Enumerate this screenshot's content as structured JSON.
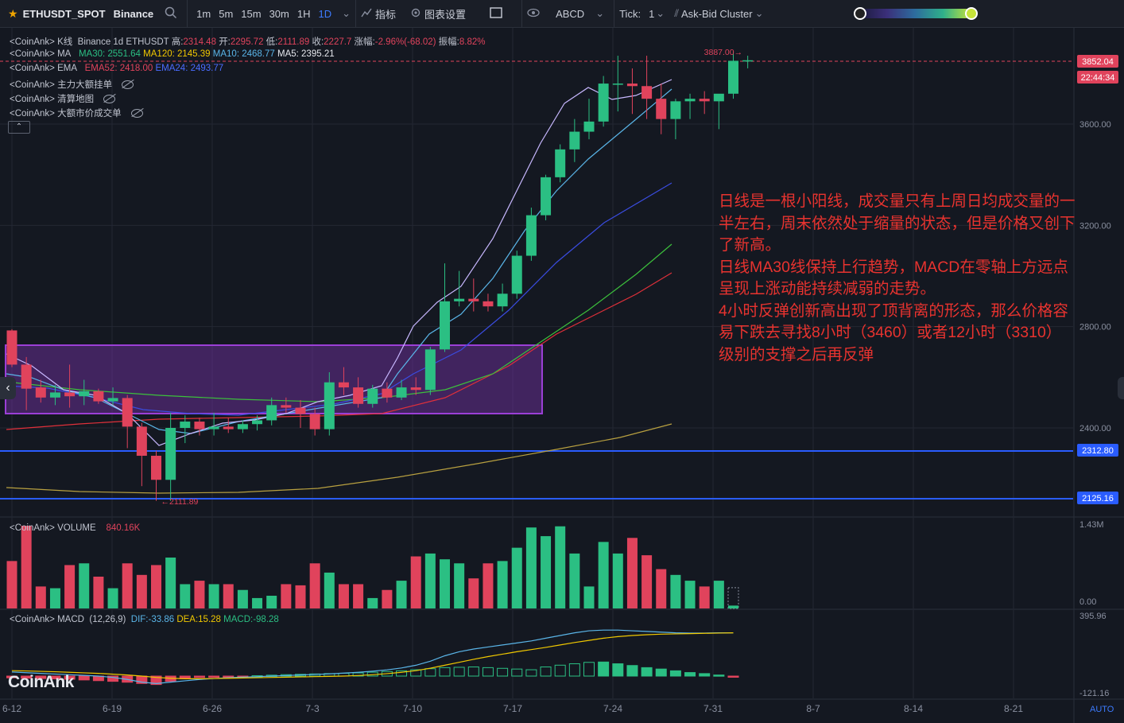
{
  "toolbar": {
    "symbol": "ETHUSDT_SPOT",
    "exchange": "Binance",
    "timeframes": [
      "1m",
      "5m",
      "15m",
      "30m",
      "1H",
      "1D"
    ],
    "active_timeframe": "1D",
    "indicators_label": "指标",
    "chart_settings_label": "图表设置",
    "abcd_label": "ABCD",
    "tick_label": "Tick:",
    "tick_value": "1",
    "cluster_label": "Ask-Bid Cluster"
  },
  "legend": {
    "kline": {
      "prefix": "<CoinAnk> K线",
      "source": "Binance 1d ETHUSDT",
      "high_label": "高:",
      "high": "2314.48",
      "open_label": "开:",
      "open": "2295.72",
      "low_label": "低:",
      "low": "2111.89",
      "close_label": "收:",
      "close": "2227.7",
      "change_label": "涨幅:",
      "change": "-2.96%(-68.02)",
      "amp_label": "振幅:",
      "amp": "8.82%"
    },
    "ma": {
      "prefix": "<CoinAnk> MA",
      "ma30": "MA30: 2551.64",
      "ma120": "MA120: 2145.39",
      "ma10": "MA10: 2468.77",
      "ma5": "MA5: 2395.21"
    },
    "ema": {
      "prefix": "<CoinAnk> EMA",
      "ema52": "EMA52: 2418.00",
      "ema24": "EMA24: 2493.77"
    },
    "orders": "<CoinAnk> 主力大额挂单",
    "liq": "<CoinAnk> 清算地图",
    "bigtrades": "<CoinAnk> 大额市价成交单",
    "volume_prefix": "<CoinAnk> VOLUME",
    "volume_value": "840.16K",
    "macd_prefix": "<CoinAnk> MACD",
    "macd_params": "(12,26,9)",
    "dif": "DIF:-33.86",
    "dea": "DEA:15.28",
    "macd": "MACD:-98.28"
  },
  "annotation": "日线是一根小阳线，成交量只有上周日均成交量的一半左右，周末依然处于缩量的状态，但是价格又创下了新高。\n日线MA30线保持上行趋势，MACD在零轴上方远点呈现上涨动能持续减弱的走势。\n4小时反弹创新高出现了顶背离的形态，那么价格容易下跌去寻找8小时（3460）或者12小时（3310）级别的支撑之后再反弹",
  "watermark": "CoinAnk",
  "auto_label": "AUTO",
  "colors": {
    "up": "#2bbf83",
    "down": "#e0435c",
    "bg": "#141821",
    "grid": "#232733",
    "box": "#9b3fd6",
    "hline": "#2a5cff"
  },
  "chart_data": {
    "type": "candlestick",
    "price_axis": {
      "ticks": [
        "3600.00",
        "3200.00",
        "2800.00",
        "2400.00"
      ],
      "min": 2000,
      "max": 3950
    },
    "x_ticks": [
      "6-12",
      "6-19",
      "6-26",
      "7-3",
      "7-10",
      "7-17",
      "7-24",
      "7-31",
      "8-7",
      "8-14",
      "8-21"
    ],
    "price_labels": {
      "current": "3852.04",
      "countdown": "22:44:34",
      "level1": "2312.80",
      "level2": "2125.16",
      "high_mark": "3887.00",
      "low_mark": "2111.89"
    },
    "candles": [
      [
        2785,
        2790,
        2640,
        2650
      ],
      [
        2650,
        2680,
        2470,
        2555
      ],
      [
        2560,
        2590,
        2500,
        2520
      ],
      [
        2520,
        2570,
        2490,
        2540
      ],
      [
        2540,
        2650,
        2480,
        2525
      ],
      [
        2525,
        2590,
        2490,
        2545
      ],
      [
        2545,
        2555,
        2495,
        2505
      ],
      [
        2505,
        2560,
        2490,
        2518
      ],
      [
        2518,
        2530,
        2320,
        2405
      ],
      [
        2405,
        2420,
        2170,
        2290
      ],
      [
        2290,
        2310,
        2112,
        2195
      ],
      [
        2195,
        2460,
        2112,
        2400
      ],
      [
        2400,
        2450,
        2340,
        2425
      ],
      [
        2425,
        2440,
        2370,
        2395
      ],
      [
        2395,
        2460,
        2370,
        2405
      ],
      [
        2405,
        2440,
        2380,
        2395
      ],
      [
        2395,
        2430,
        2380,
        2415
      ],
      [
        2415,
        2450,
        2390,
        2430
      ],
      [
        2430,
        2520,
        2410,
        2490
      ],
      [
        2490,
        2520,
        2460,
        2480
      ],
      [
        2480,
        2510,
        2400,
        2455
      ],
      [
        2455,
        2480,
        2370,
        2395
      ],
      [
        2395,
        2620,
        2370,
        2580
      ],
      [
        2580,
        2640,
        2530,
        2560
      ],
      [
        2560,
        2600,
        2480,
        2495
      ],
      [
        2495,
        2570,
        2480,
        2555
      ],
      [
        2555,
        2580,
        2500,
        2520
      ],
      [
        2520,
        2590,
        2510,
        2560
      ],
      [
        2560,
        2600,
        2530,
        2550
      ],
      [
        2550,
        2720,
        2530,
        2710
      ],
      [
        2710,
        3050,
        2700,
        2900
      ],
      [
        2900,
        3020,
        2880,
        2910
      ],
      [
        2910,
        2990,
        2860,
        2900
      ],
      [
        2900,
        2930,
        2860,
        2880
      ],
      [
        2880,
        2970,
        2860,
        2930
      ],
      [
        2930,
        3100,
        2910,
        3080
      ],
      [
        3080,
        3270,
        3060,
        3240
      ],
      [
        3240,
        3400,
        3220,
        3390
      ],
      [
        3390,
        3520,
        3370,
        3500
      ],
      [
        3500,
        3620,
        3450,
        3570
      ],
      [
        3570,
        3700,
        3540,
        3610
      ],
      [
        3610,
        3790,
        3590,
        3760
      ],
      [
        3760,
        3870,
        3650,
        3760
      ],
      [
        3760,
        3820,
        3640,
        3750
      ],
      [
        3750,
        3870,
        3620,
        3700
      ],
      [
        3700,
        3760,
        3560,
        3620
      ],
      [
        3620,
        3700,
        3540,
        3690
      ],
      [
        3690,
        3720,
        3620,
        3700
      ],
      [
        3700,
        3730,
        3640,
        3690
      ],
      [
        3690,
        3710,
        3580,
        3720
      ],
      [
        3720,
        3887,
        3700,
        3850
      ],
      [
        3850,
        3870,
        3820,
        3852
      ]
    ],
    "volume_axis": {
      "max_label": "1.43M",
      "min_label": "0.00"
    },
    "volume": [
      0.82,
      1.43,
      0.38,
      0.35,
      0.75,
      0.78,
      0.55,
      0.35,
      0.78,
      0.58,
      0.75,
      0.88,
      0.42,
      0.48,
      0.42,
      0.42,
      0.32,
      0.18,
      0.22,
      0.42,
      0.4,
      0.78,
      0.62,
      0.42,
      0.42,
      0.18,
      0.32,
      0.48,
      0.9,
      0.95,
      0.85,
      0.78,
      0.52,
      0.78,
      0.82,
      1.05,
      1.4,
      1.25,
      1.42,
      0.95,
      0.38,
      1.15,
      0.95,
      1.22,
      0.92,
      0.68,
      0.58,
      0.48,
      0.38,
      0.48,
      0.05
    ],
    "macd_axis": {
      "max_label": "395.96",
      "min_label": "-121.16"
    },
    "macd_hist": [
      -10,
      -12,
      -14,
      -16,
      -18,
      -22,
      -26,
      -30,
      -35,
      -42,
      -48,
      -30,
      -15,
      -8,
      -5,
      -4,
      -2,
      2,
      5,
      8,
      10,
      12,
      14,
      16,
      18,
      22,
      26,
      30,
      36,
      42,
      48,
      50,
      52,
      48,
      44,
      40,
      36,
      52,
      62,
      70,
      78,
      80,
      70,
      60,
      48,
      40,
      30,
      20,
      14,
      6,
      -6
    ],
    "dif": [
      30,
      25,
      20,
      15,
      10,
      5,
      0,
      -10,
      -25,
      -45,
      -55,
      -45,
      -35,
      -25,
      -18,
      -12,
      -8,
      -4,
      0,
      4,
      8,
      12,
      16,
      22,
      28,
      36,
      46,
      60,
      80,
      110,
      150,
      180,
      200,
      215,
      230,
      245,
      260,
      280,
      300,
      320,
      335,
      340,
      340,
      335,
      330,
      325,
      320,
      318,
      318,
      320,
      320
    ],
    "dea": [
      40,
      38,
      35,
      32,
      28,
      24,
      20,
      14,
      8,
      0,
      -10,
      -16,
      -20,
      -20,
      -18,
      -16,
      -14,
      -12,
      -10,
      -8,
      -6,
      -4,
      -2,
      0,
      4,
      10,
      18,
      28,
      40,
      58,
      80,
      102,
      124,
      144,
      162,
      180,
      196,
      212,
      230,
      248,
      264,
      280,
      292,
      300,
      306,
      310,
      312,
      314,
      316,
      318,
      320
    ]
  }
}
